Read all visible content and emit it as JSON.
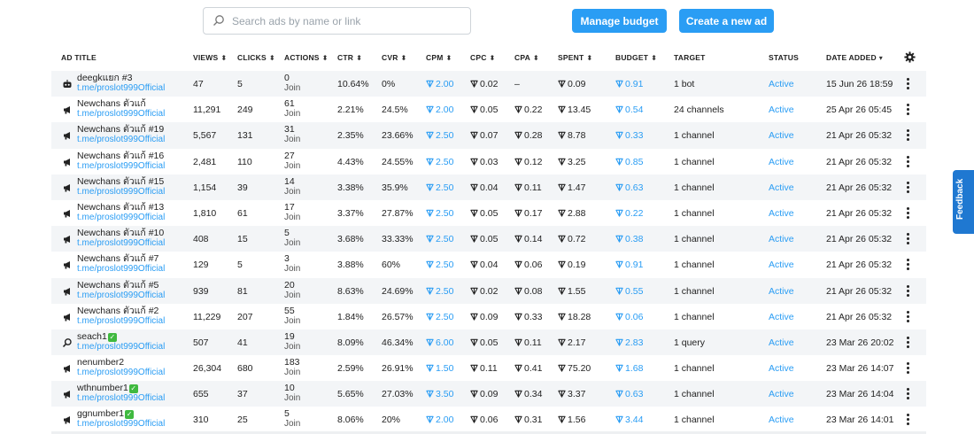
{
  "search": {
    "placeholder": "Search ads by name or link",
    "value": ""
  },
  "buttons": {
    "manage_budget": "Manage budget",
    "create_ad": "Create a new ad"
  },
  "feedback": "Feedback",
  "columns": [
    {
      "key": "title",
      "label": "AD TITLE",
      "sort": ""
    },
    {
      "key": "views",
      "label": "VIEWS",
      "sort": "⬍"
    },
    {
      "key": "clicks",
      "label": "CLICKS",
      "sort": "⬍"
    },
    {
      "key": "actions",
      "label": "ACTIONS",
      "sort": "⬍"
    },
    {
      "key": "ctr",
      "label": "CTR",
      "sort": "⬍"
    },
    {
      "key": "cvr",
      "label": "CVR",
      "sort": "⬍"
    },
    {
      "key": "cpm",
      "label": "CPM",
      "sort": "⬍"
    },
    {
      "key": "cpc",
      "label": "CPC",
      "sort": "⬍"
    },
    {
      "key": "cpa",
      "label": "CPA",
      "sort": "⬍"
    },
    {
      "key": "spent",
      "label": "SPENT",
      "sort": "⬍"
    },
    {
      "key": "budget",
      "label": "BUDGET",
      "sort": "⬍"
    },
    {
      "key": "target",
      "label": "TARGET",
      "sort": ""
    },
    {
      "key": "status",
      "label": "STATUS",
      "sort": ""
    },
    {
      "key": "date",
      "label": "DATE ADDED",
      "sort": "▾"
    }
  ],
  "rows": [
    {
      "icon": "bot-icon",
      "title": "deegkแยก #3",
      "verified": false,
      "link": "t.me/proslot999Official",
      "views": "47",
      "clicks": "5",
      "actions": "0",
      "actions_sub": "Join",
      "ctr": "10.64%",
      "cvr": "0%",
      "cpm": "2.00",
      "cpc": "0.02",
      "cpa": "–",
      "spent": "0.09",
      "budget": "0.91",
      "target": "1 bot",
      "status": "Active",
      "date": "15 Jun 26 18:59"
    },
    {
      "icon": "megaphone-icon",
      "title": "Newchans ตัวแก้",
      "verified": false,
      "link": "t.me/proslot999Official",
      "views": "11,291",
      "clicks": "249",
      "actions": "61",
      "actions_sub": "Join",
      "ctr": "2.21%",
      "cvr": "24.5%",
      "cpm": "2.00",
      "cpc": "0.05",
      "cpa": "0.22",
      "spent": "13.45",
      "budget": "0.54",
      "target": "24 channels",
      "status": "Active",
      "date": "25 Apr 26 05:45"
    },
    {
      "icon": "megaphone-icon",
      "title": "Newchans ตัวแก้ #19",
      "verified": false,
      "link": "t.me/proslot999Official",
      "views": "5,567",
      "clicks": "131",
      "actions": "31",
      "actions_sub": "Join",
      "ctr": "2.35%",
      "cvr": "23.66%",
      "cpm": "2.50",
      "cpc": "0.07",
      "cpa": "0.28",
      "spent": "8.78",
      "budget": "0.33",
      "target": "1 channel",
      "status": "Active",
      "date": "21 Apr 26 05:32"
    },
    {
      "icon": "megaphone-icon",
      "title": "Newchans ตัวแก้ #16",
      "verified": false,
      "link": "t.me/proslot999Official",
      "views": "2,481",
      "clicks": "110",
      "actions": "27",
      "actions_sub": "Join",
      "ctr": "4.43%",
      "cvr": "24.55%",
      "cpm": "2.50",
      "cpc": "0.03",
      "cpa": "0.12",
      "spent": "3.25",
      "budget": "0.85",
      "target": "1 channel",
      "status": "Active",
      "date": "21 Apr 26 05:32"
    },
    {
      "icon": "megaphone-icon",
      "title": "Newchans ตัวแก้ #15",
      "verified": false,
      "link": "t.me/proslot999Official",
      "views": "1,154",
      "clicks": "39",
      "actions": "14",
      "actions_sub": "Join",
      "ctr": "3.38%",
      "cvr": "35.9%",
      "cpm": "2.50",
      "cpc": "0.04",
      "cpa": "0.11",
      "spent": "1.47",
      "budget": "0.63",
      "target": "1 channel",
      "status": "Active",
      "date": "21 Apr 26 05:32"
    },
    {
      "icon": "megaphone-icon",
      "title": "Newchans ตัวแก้ #13",
      "verified": false,
      "link": "t.me/proslot999Official",
      "views": "1,810",
      "clicks": "61",
      "actions": "17",
      "actions_sub": "Join",
      "ctr": "3.37%",
      "cvr": "27.87%",
      "cpm": "2.50",
      "cpc": "0.05",
      "cpa": "0.17",
      "spent": "2.88",
      "budget": "0.22",
      "target": "1 channel",
      "status": "Active",
      "date": "21 Apr 26 05:32"
    },
    {
      "icon": "megaphone-icon",
      "title": "Newchans ตัวแก้ #10",
      "verified": false,
      "link": "t.me/proslot999Official",
      "views": "408",
      "clicks": "15",
      "actions": "5",
      "actions_sub": "Join",
      "ctr": "3.68%",
      "cvr": "33.33%",
      "cpm": "2.50",
      "cpc": "0.05",
      "cpa": "0.14",
      "spent": "0.72",
      "budget": "0.38",
      "target": "1 channel",
      "status": "Active",
      "date": "21 Apr 26 05:32"
    },
    {
      "icon": "megaphone-icon",
      "title": "Newchans ตัวแก้ #7",
      "verified": false,
      "link": "t.me/proslot999Official",
      "views": "129",
      "clicks": "5",
      "actions": "3",
      "actions_sub": "Join",
      "ctr": "3.88%",
      "cvr": "60%",
      "cpm": "2.50",
      "cpc": "0.04",
      "cpa": "0.06",
      "spent": "0.19",
      "budget": "0.91",
      "target": "1 channel",
      "status": "Active",
      "date": "21 Apr 26 05:32"
    },
    {
      "icon": "megaphone-icon",
      "title": "Newchans ตัวแก้ #5",
      "verified": false,
      "link": "t.me/proslot999Official",
      "views": "939",
      "clicks": "81",
      "actions": "20",
      "actions_sub": "Join",
      "ctr": "8.63%",
      "cvr": "24.69%",
      "cpm": "2.50",
      "cpc": "0.02",
      "cpa": "0.08",
      "spent": "1.55",
      "budget": "0.55",
      "target": "1 channel",
      "status": "Active",
      "date": "21 Apr 26 05:32"
    },
    {
      "icon": "megaphone-icon",
      "title": "Newchans ตัวแก้ #2",
      "verified": false,
      "link": "t.me/proslot999Official",
      "views": "11,229",
      "clicks": "207",
      "actions": "55",
      "actions_sub": "Join",
      "ctr": "1.84%",
      "cvr": "26.57%",
      "cpm": "2.50",
      "cpc": "0.09",
      "cpa": "0.33",
      "spent": "18.28",
      "budget": "0.06",
      "target": "1 channel",
      "status": "Active",
      "date": "21 Apr 26 05:32"
    },
    {
      "icon": "search-icon",
      "title": "seach1",
      "verified": true,
      "link": "t.me/proslot999Official",
      "views": "507",
      "clicks": "41",
      "actions": "19",
      "actions_sub": "Join",
      "ctr": "8.09%",
      "cvr": "46.34%",
      "cpm": "6.00",
      "cpc": "0.05",
      "cpa": "0.11",
      "spent": "2.17",
      "budget": "2.83",
      "target": "1 query",
      "status": "Active",
      "date": "23 Mar 26 20:02"
    },
    {
      "icon": "megaphone-icon",
      "title": "nenumber2",
      "verified": false,
      "link": "t.me/proslot999Official",
      "views": "26,304",
      "clicks": "680",
      "actions": "183",
      "actions_sub": "Join",
      "ctr": "2.59%",
      "cvr": "26.91%",
      "cpm": "1.50",
      "cpc": "0.11",
      "cpa": "0.41",
      "spent": "75.20",
      "budget": "1.68",
      "target": "1 channel",
      "status": "Active",
      "date": "23 Mar 26 14:07"
    },
    {
      "icon": "megaphone-icon",
      "title": "wthnumber1",
      "verified": true,
      "link": "t.me/proslot999Official",
      "views": "655",
      "clicks": "37",
      "actions": "10",
      "actions_sub": "Join",
      "ctr": "5.65%",
      "cvr": "27.03%",
      "cpm": "3.50",
      "cpc": "0.09",
      "cpa": "0.34",
      "spent": "3.37",
      "budget": "0.63",
      "target": "1 channel",
      "status": "Active",
      "date": "23 Mar 26 14:04"
    },
    {
      "icon": "megaphone-icon",
      "title": "ggnumber1",
      "verified": true,
      "link": "t.me/proslot999Official",
      "views": "310",
      "clicks": "25",
      "actions": "5",
      "actions_sub": "Join",
      "ctr": "8.06%",
      "cvr": "20%",
      "cpm": "2.00",
      "cpc": "0.06",
      "cpa": "0.31",
      "spent": "1.56",
      "budget": "3.44",
      "target": "1 channel",
      "status": "Active",
      "date": "23 Mar 26 14:01"
    }
  ],
  "colors": {
    "accent": "#2a9df4",
    "row_alt": "#f3f5f7",
    "feedback": "#1f78d1",
    "verified": "#3fb93f"
  }
}
